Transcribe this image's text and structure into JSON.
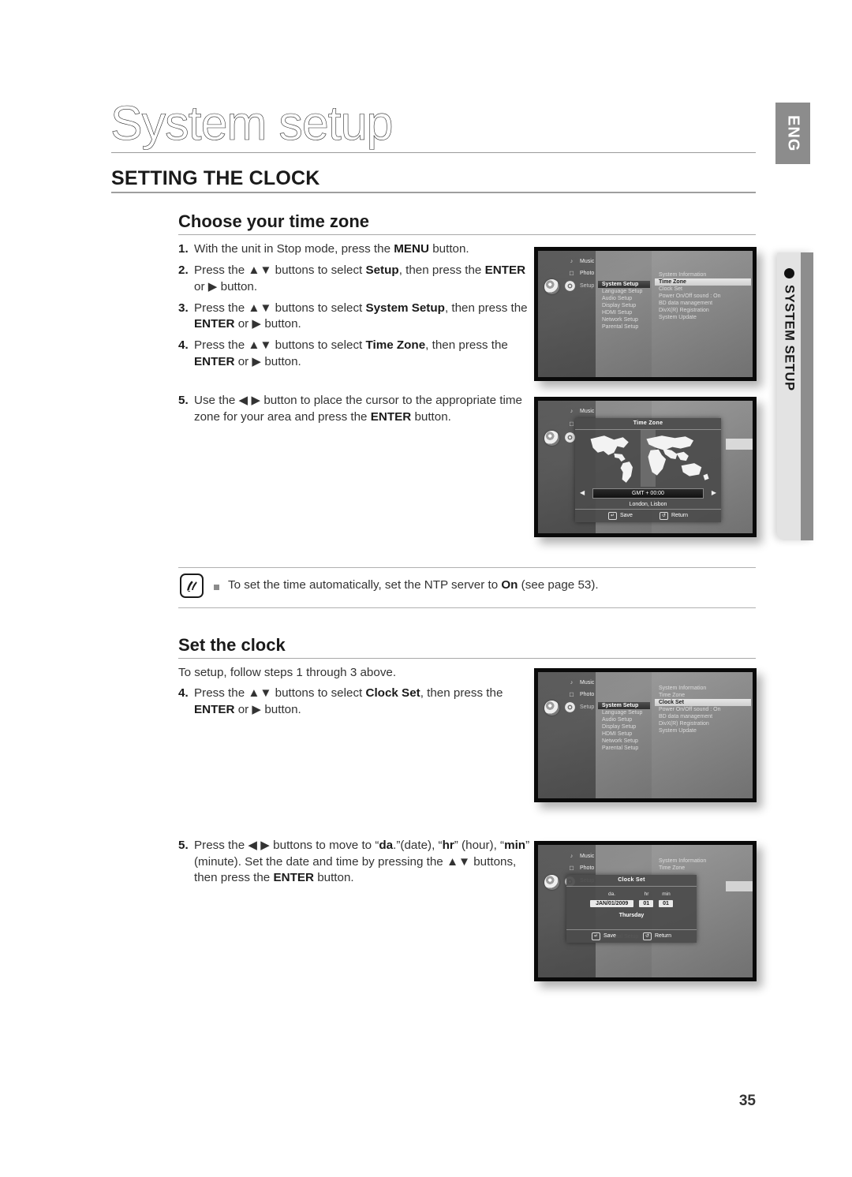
{
  "page": {
    "title": "System setup",
    "section_heading": "SETTING THE CLOCK",
    "page_number": "35",
    "lang_tab": "ENG",
    "side_tab": "SYSTEM SETUP"
  },
  "timezone_section": {
    "heading": "Choose your time zone",
    "steps": [
      {
        "num": "1.",
        "html": "With the unit in Stop mode, press the <b>MENU</b> button."
      },
      {
        "num": "2.",
        "html": "Press the ▲▼ buttons to select <b>Setup</b>, then press the <b>ENTER</b> or ▶ button."
      },
      {
        "num": "3.",
        "html": "Press the ▲▼ buttons to select <b>System Setup</b>, then press the <b>ENTER</b> or ▶ button."
      },
      {
        "num": "4.",
        "html": "Press the ▲▼ buttons to select <b>Time Zone</b>, then press the <b>ENTER</b> or ▶ button."
      }
    ],
    "step5": {
      "num": "5.",
      "html": "Use the ◀ ▶ button to place the cursor to the appropriate time zone for your area and press the <b>ENTER</b> button."
    }
  },
  "note": {
    "icon": "memo-icon",
    "bullet": "■",
    "html": "To set the time automatically, set the NTP server to <b>On</b> (see page 53)."
  },
  "clock_section": {
    "heading": "Set the clock",
    "intro": "To setup, follow steps 1 through 3 above.",
    "step4": {
      "num": "4.",
      "html": "Press the ▲▼ buttons to select <b>Clock Set</b>, then press the <b>ENTER</b> or ▶ button."
    },
    "step5": {
      "num": "5.",
      "html": "Press the ◀ ▶ buttons to move to “<b>da</b>.”(date), “<b>hr</b>” (hour), “<b>min</b>” (minute). Set the date and time by pressing the ▲▼ buttons, then press the <b>ENTER</b> button."
    }
  },
  "osd": {
    "sources": [
      {
        "label": "Music",
        "icon": "music-note-icon"
      },
      {
        "label": "Photo",
        "icon": "photo-icon"
      },
      {
        "label": "Setup",
        "icon": "gear-icon"
      }
    ],
    "setup_menu": [
      "System Setup",
      "Language Setup",
      "Audio Setup",
      "Display Setup",
      "HDMI Setup",
      "Network Setup",
      "Parental Setup"
    ],
    "system_menu": [
      "System Information",
      "Time Zone",
      "Clock Set",
      "Power On/Off sound   :   On",
      "BD data management",
      "DivX(R) Registration",
      "System Update"
    ],
    "screen1": {
      "selected_setup": "System Setup",
      "selected_system": "Time Zone"
    },
    "screen3": {
      "selected_setup": "System Setup",
      "selected_system": "Clock Set"
    },
    "timezone_dialog": {
      "title": "Time Zone",
      "gmt": "GMT + 00:00",
      "city": "London, Lisbon",
      "save": "Save",
      "return": "Return",
      "left_arrow": "◀",
      "right_arrow": "▶"
    },
    "clockset_dialog": {
      "title": "Clock Set",
      "headers": [
        "da.",
        "hr",
        "min"
      ],
      "date": "JAN/01/2009",
      "hour": "01",
      "minute": "01",
      "weekday": "Thursday",
      "save": "Save",
      "return": "Return"
    }
  }
}
